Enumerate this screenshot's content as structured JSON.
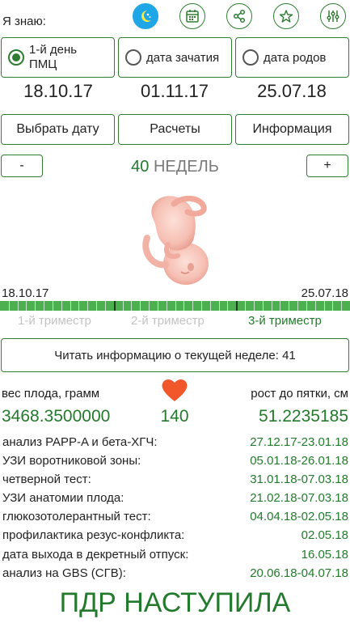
{
  "header": {
    "i_know_label": "Я знаю:",
    "icons": [
      "calendar-app-icon",
      "calendar-icon",
      "share-icon",
      "star-icon",
      "settings-sliders-icon"
    ]
  },
  "radios": [
    {
      "label": "1-й день ПМЦ",
      "checked": true,
      "date": "18.10.17"
    },
    {
      "label": "дата зачатия",
      "checked": false,
      "date": "01.11.17"
    },
    {
      "label": "дата родов",
      "checked": false,
      "date": "25.07.18"
    }
  ],
  "buttons": {
    "select_date": "Выбрать дату",
    "calculations": "Расчеты",
    "information": "Информация",
    "minus": "-",
    "plus": "+"
  },
  "weeks": {
    "number": "40",
    "label": "НЕДЕЛЬ"
  },
  "timeline": {
    "start_date": "18.10.17",
    "end_date": "25.07.18",
    "progress": 1.0,
    "trimesters": [
      {
        "label": "1-й триместр",
        "active": false
      },
      {
        "label": "2-й триместр",
        "active": false
      },
      {
        "label": "3-й триместр",
        "active": true
      }
    ]
  },
  "read_button": "Читать информацию о текущей неделе: 41",
  "stats": {
    "weight_label": "вес плода, грамм",
    "height_label": "рост до пятки, см",
    "weight_value": "3468.3500000",
    "heartbeat": "140",
    "height_value": "51.2235185"
  },
  "schedule": [
    {
      "label": "анализ PAPP-A и бета-ХГЧ:",
      "value": "27.12.17-23.01.18"
    },
    {
      "label": "УЗИ воротниковой зоны:",
      "value": "05.01.18-26.01.18"
    },
    {
      "label": "четверной тест:",
      "value": "31.01.18-07.03.18"
    },
    {
      "label": "УЗИ анатомии плода:",
      "value": "21.02.18-07.03.18"
    },
    {
      "label": "глюкозотолерантный тест:",
      "value": "04.04.18-02.05.18"
    },
    {
      "label": "профилактика резус-конфликта:",
      "value": "02.05.18"
    },
    {
      "label": "дата выхода в декретный отпуск:",
      "value": "16.05.18"
    },
    {
      "label": "анализ на GBS (СГВ):",
      "value": "20.06.18-04.07.18"
    }
  ],
  "footer": "ПДР НАСТУПИЛА",
  "colors": {
    "accent": "#2e7d32",
    "progress": "#4caf50",
    "heart": "#f1572b",
    "tab_active": "#1fa6e6"
  }
}
